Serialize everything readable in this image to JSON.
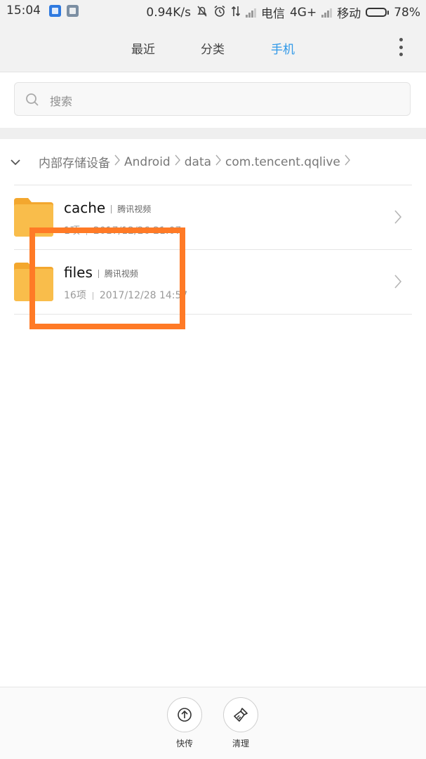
{
  "status_bar": {
    "time": "15:04",
    "speed": "0.94K/s",
    "carrier1": "电信",
    "network": "4G+",
    "carrier2": "移动",
    "battery": "78%",
    "battery_level": 0.78
  },
  "tabs": [
    {
      "label": "最近",
      "active": false
    },
    {
      "label": "分类",
      "active": false
    },
    {
      "label": "手机",
      "active": true
    }
  ],
  "search": {
    "placeholder": "搜索"
  },
  "breadcrumb": [
    "内部存储设备",
    "Android",
    "data",
    "com.tencent.qqlive"
  ],
  "files": [
    {
      "name": "cache",
      "app": "腾讯视频",
      "items": "1项",
      "date": "2017/12/26 21:07"
    },
    {
      "name": "files",
      "app": "腾讯视频",
      "items": "16项",
      "date": "2017/12/28 14:57"
    }
  ],
  "bottom_actions": [
    {
      "label": "快传",
      "icon": "upload-icon"
    },
    {
      "label": "清理",
      "icon": "broom-icon"
    }
  ],
  "colors": {
    "accent": "#2f98e8",
    "highlight": "#ff7a26",
    "folder": "#f9b842"
  }
}
